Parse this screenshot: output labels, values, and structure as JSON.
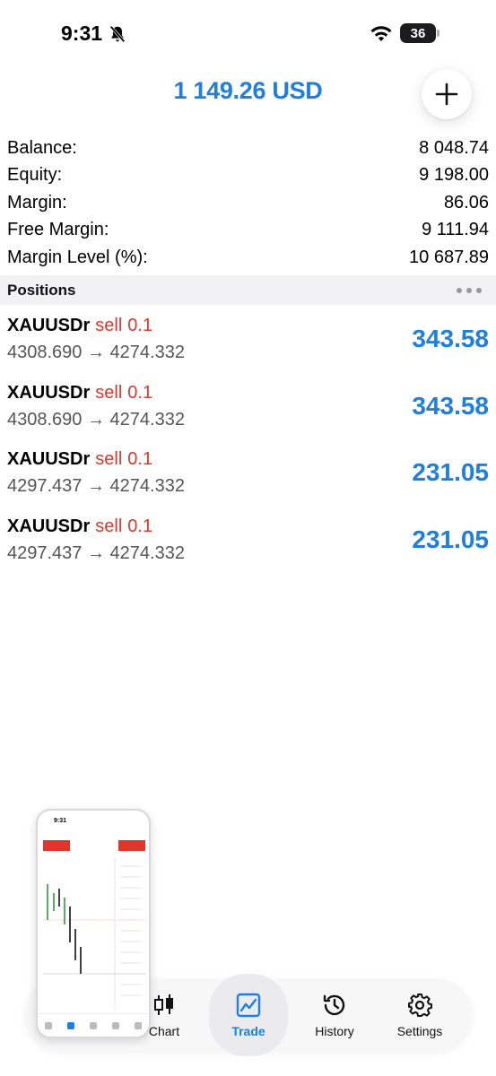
{
  "status_bar": {
    "time": "9:31",
    "battery": "36"
  },
  "header": {
    "title": "1 149.26 USD"
  },
  "summary": [
    {
      "label": "Balance:",
      "value": "8 048.74"
    },
    {
      "label": "Equity:",
      "value": "9 198.00"
    },
    {
      "label": "Margin:",
      "value": "86.06"
    },
    {
      "label": "Free Margin:",
      "value": "9 111.94"
    },
    {
      "label": "Margin Level (%):",
      "value": "10 687.89"
    }
  ],
  "positions": {
    "title": "Positions",
    "items": [
      {
        "symbol": "XAUUSDr",
        "side": "sell",
        "volume": "0.1",
        "prices": "4308.690 → 4274.332",
        "profit": "343.58"
      },
      {
        "symbol": "XAUUSDr",
        "side": "sell",
        "volume": "0.1",
        "prices": "4308.690 → 4274.332",
        "profit": "343.58"
      },
      {
        "symbol": "XAUUSDr",
        "side": "sell",
        "volume": "0.1",
        "prices": "4297.437 → 4274.332",
        "profit": "231.05"
      },
      {
        "symbol": "XAUUSDr",
        "side": "sell",
        "volume": "0.1",
        "prices": "4297.437 → 4274.332",
        "profit": "231.05"
      }
    ]
  },
  "tabs": [
    {
      "label": "Chart",
      "icon": "candlestick-icon"
    },
    {
      "label": "Trade",
      "icon": "trade-chart-icon",
      "active": true
    },
    {
      "label": "History",
      "icon": "history-icon"
    },
    {
      "label": "Settings",
      "icon": "gear-icon"
    }
  ],
  "thumbnail": {
    "time": "9:31"
  },
  "colors": {
    "accent": "#1e7fe0",
    "sell": "#e0352b"
  }
}
